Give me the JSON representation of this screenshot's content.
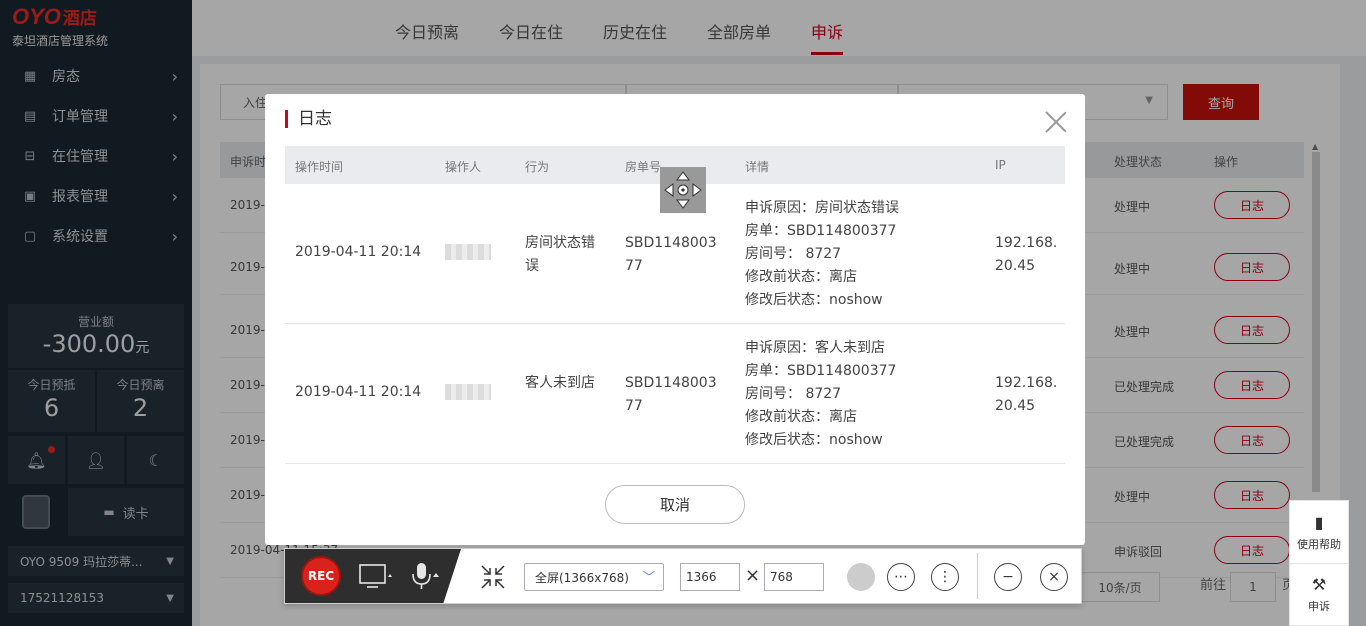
{
  "brand": {
    "logo_oyo": "OYO",
    "logo_hotel": "酒店",
    "subtitle": "泰坦酒店管理系统"
  },
  "sidebar": {
    "menu": [
      {
        "label": "房态",
        "icon": "grid-icon"
      },
      {
        "label": "订单管理",
        "icon": "document-icon"
      },
      {
        "label": "在住管理",
        "icon": "bed-icon"
      },
      {
        "label": "报表管理",
        "icon": "chart-icon"
      },
      {
        "label": "系统设置",
        "icon": "monitor-icon"
      }
    ],
    "revenue_label": "营业额",
    "revenue_value": "-300.00",
    "revenue_unit": "元",
    "today_arrive_label": "今日预抵",
    "today_arrive_value": "6",
    "today_depart_label": "今日预离",
    "today_depart_value": "2",
    "read_card_label": "读卡",
    "hotel_select": "OYO 9509 玛拉莎蒂...",
    "phone_select": "17521128153"
  },
  "tabs": [
    "今日预离",
    "今日在住",
    "历史在住",
    "全部房单",
    "申诉"
  ],
  "filters": {
    "checkin_label": "入住"
  },
  "query_button": "查询",
  "table": {
    "headers": {
      "complain_time": "申诉时",
      "status": "处理状态",
      "action": "操作"
    },
    "rows": [
      {
        "date": "2019-0",
        "status": "处理中"
      },
      {
        "date": "2019-0",
        "status": "处理中"
      },
      {
        "date": "2019-0",
        "status": "处理中"
      },
      {
        "date": "2019-0",
        "status": "已处理完成"
      },
      {
        "date": "2019-0",
        "status": "已处理完成"
      },
      {
        "date": "2019-0",
        "status": "处理中"
      },
      {
        "date": "2019-04-11 15:37",
        "status": "申诉驳回"
      }
    ],
    "log_label": "日志"
  },
  "pager": {
    "page_size": "10条/页",
    "goto_label": "前往",
    "page_value": "1",
    "page_suffix": "页"
  },
  "help": {
    "help_label": "使用帮助",
    "complain_label": "申诉"
  },
  "modal": {
    "title": "日志",
    "headers": [
      "操作时间",
      "操作人",
      "行为",
      "房单号",
      "详情",
      "IP"
    ],
    "rows": [
      {
        "time": "2019-04-11 20:14",
        "action": "房间状态错误",
        "order": "SBD114800377",
        "details": [
          "申诉原因：房间状态错误",
          "房单：SBD114800377",
          "房间号：  8727",
          "修改前状态：离店",
          "修改后状态：noshow"
        ],
        "ip": "192.168.20.45"
      },
      {
        "time": "2019-04-11 20:14",
        "action": "客人未到店",
        "order": "SBD114800377",
        "details": [
          "申诉原因：客人未到店",
          "房单：SBD114800377",
          "房间号：  8727",
          "修改前状态：离店",
          "修改后状态：noshow"
        ],
        "ip": "192.168.20.45"
      }
    ],
    "cancel": "取消"
  },
  "recorder": {
    "rec_label": "REC",
    "mode": "全屏(1366x768)",
    "width": "1366",
    "height": "768",
    "times": "×"
  }
}
